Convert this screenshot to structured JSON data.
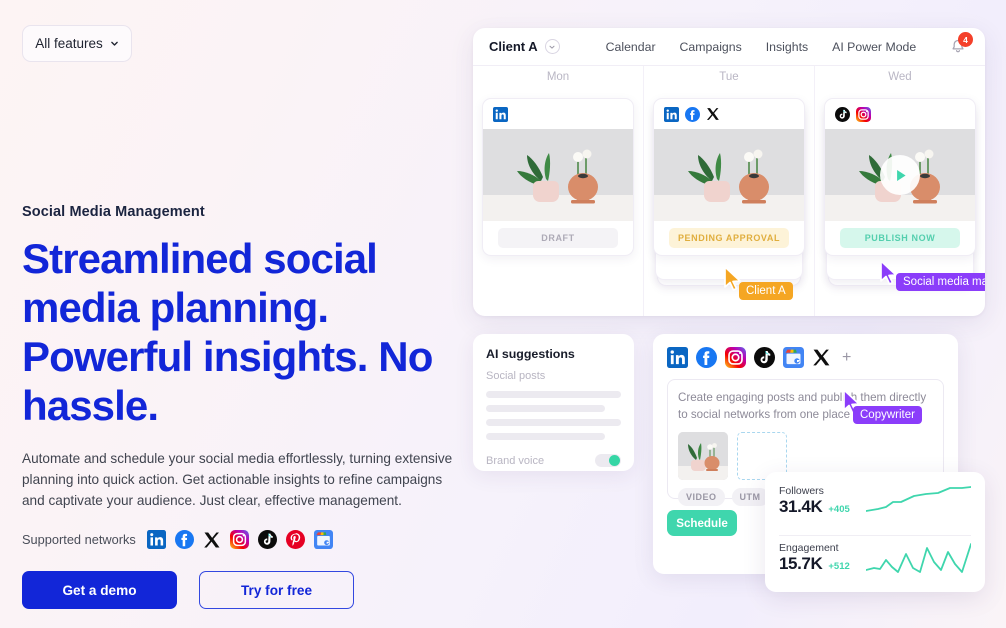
{
  "features_button": {
    "label": "All features",
    "icon": "chevron-down-icon"
  },
  "hero": {
    "eyebrow": "Social Media Management",
    "headline": "Streamlined social media planning. Powerful insights. No hassle.",
    "paragraph": "Automate and schedule your social media effortlessly, turning extensive planning into quick action. Get actionable insights to refine campaigns and captivate your audience. Just clear, effective management.",
    "networks_label": "Supported networks",
    "networks": [
      "linkedin-icon",
      "facebook-icon",
      "x-icon",
      "instagram-icon",
      "tiktok-icon",
      "pinterest-icon",
      "google-business-icon"
    ],
    "cta_primary": "Get a demo",
    "cta_secondary": "Try for free",
    "accent_color": "#1226d8"
  },
  "calendar": {
    "client": "Client A",
    "client_chevron": "chevron-down-icon",
    "nav": [
      "Calendar",
      "Campaigns",
      "Insights",
      "AI Power Mode"
    ],
    "notifications": {
      "icon": "bell-icon",
      "count": "4",
      "badge_color": "#f4402a"
    },
    "days": [
      "Mon",
      "Tue",
      "Wed"
    ],
    "posts": [
      {
        "day": "Mon",
        "networks": [
          "linkedin-icon"
        ],
        "status": "DRAFT",
        "status_style": "draft",
        "has_video": false,
        "stacked": false
      },
      {
        "day": "Tue",
        "networks": [
          "linkedin-icon",
          "facebook-icon",
          "x-icon"
        ],
        "status": "PENDING APPROVAL",
        "status_style": "pending",
        "has_video": false,
        "stacked": true
      },
      {
        "day": "Wed",
        "networks": [
          "tiktok-icon",
          "instagram-icon"
        ],
        "status": "PUBLISH NOW",
        "status_style": "publish",
        "has_video": true,
        "stacked": true
      }
    ],
    "cursors": [
      {
        "label": "Client A",
        "color": "#f5a623"
      },
      {
        "label": "Social media manager",
        "color": "#8b3dfa"
      }
    ]
  },
  "ai_suggestions": {
    "title": "AI suggestions",
    "subtitle": "Social posts",
    "footer_label": "Brand voice",
    "toggle_on": true,
    "toggle_color": "#35d6a5"
  },
  "composer": {
    "networks": [
      "linkedin-icon",
      "facebook-icon",
      "instagram-icon",
      "tiktok-icon",
      "google-business-icon",
      "x-icon"
    ],
    "add_label": "+",
    "placeholder": "Create engaging posts and publish them directly to social networks from one place",
    "tags": [
      "VIDEO",
      "UTM"
    ],
    "submit_label": "Schedule",
    "submit_color": "#3fd6ad",
    "cursor": {
      "label": "Copywriter",
      "color": "#8b3dfa"
    }
  },
  "stats": {
    "accent_color": "#3fd6ad",
    "items": [
      {
        "label": "Followers",
        "value": "31.4K",
        "delta": "+405",
        "spark": "0,26 12,24 20,22 27,17 35,17 48,11 60,9 72,8 84,3 96,3 105,2"
      },
      {
        "label": "Engagement",
        "value": "15.7K",
        "delta": "+512",
        "spark": "0,28 8,26 14,27 20,18 26,25 32,30 40,12 47,26 54,30 61,6 68,20 75,28 82,10 89,22 96,30 105,2"
      }
    ]
  }
}
